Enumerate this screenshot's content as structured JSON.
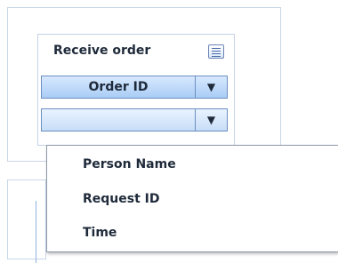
{
  "card": {
    "title": "Receive order",
    "title_icon": "list-icon"
  },
  "combo_primary": {
    "value": "Order ID",
    "arrow_icon": "chevron-down-icon",
    "arrow_glyph": "▼"
  },
  "combo_secondary": {
    "value": "",
    "arrow_icon": "chevron-down-icon",
    "arrow_glyph": "▼"
  },
  "dropdown": {
    "items": [
      {
        "label": "Person Name"
      },
      {
        "label": "Request ID"
      },
      {
        "label": "Time"
      }
    ]
  },
  "colors": {
    "accent_blue": "#a9ccf5",
    "border_blue": "#6b8fc0",
    "text": "#1f2a3a"
  }
}
